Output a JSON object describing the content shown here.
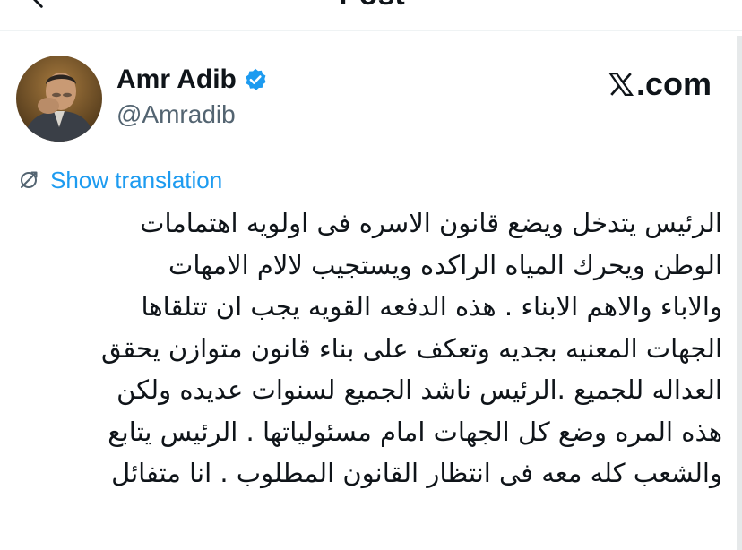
{
  "header": {
    "title": "Post",
    "back_icon": "back-arrow-icon"
  },
  "author": {
    "name": "Amr Adib",
    "handle": "@Amradib",
    "verified": true,
    "verified_color": "#1d9bf0",
    "avatar_icon": "avatar"
  },
  "brand": {
    "logo_icon": "x-logo-icon",
    "text": ".com"
  },
  "translation": {
    "label": "Show translation",
    "icon": "translate-icon",
    "color": "#1d9bf0"
  },
  "tweet": {
    "lines": [
      "الرئيس يتدخل ويضع قانون الاسره فى اولويه اهتمامات",
      "الوطن ويحرك المياه الراكده ويستجيب لالام الامهات",
      "والاباء والاهم الابناء . هذه الدفعه القويه يجب ان تتلقاها",
      "الجهات المعنيه بجديه وتعكف على بناء قانون متوازن يحقق",
      "العداله للجميع .الرئيس ناشد الجميع لسنوات عديده ولكن",
      "هذه المره وضع كل الجهات امام مسئولياتها . الرئيس يتابع",
      "والشعب كله معه فى انتظار القانون المطلوب . انا متفائل"
    ]
  }
}
